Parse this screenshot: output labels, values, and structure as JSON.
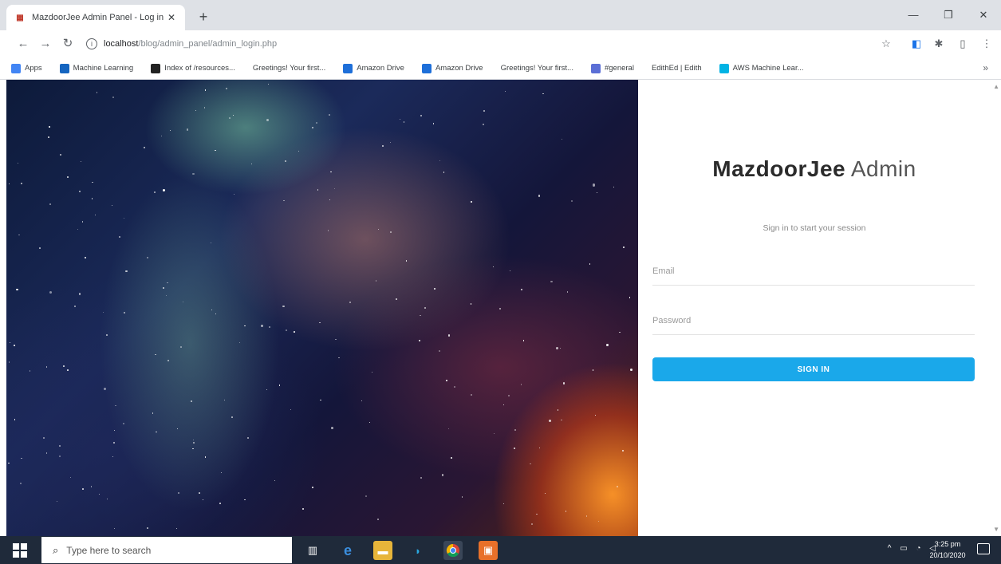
{
  "browser": {
    "tab_title": "MazdoorJee Admin Panel - Log in",
    "url_host": "localhost",
    "url_path": "/blog/admin_panel/admin_login.php",
    "bookmarks": [
      {
        "label": "Apps",
        "icon": "apps-grid-icon",
        "color": "#4285f4"
      },
      {
        "label": "Machine Learning",
        "icon": "infinity-icon",
        "color": "#1565c0"
      },
      {
        "label": "Index of /resources...",
        "icon": "dark-logo-icon",
        "color": "#222222"
      },
      {
        "label": "Greetings! Your first...",
        "icon": "",
        "color": ""
      },
      {
        "label": "Amazon Drive",
        "icon": "amazon-drive-icon",
        "color": "#1e6fd9"
      },
      {
        "label": "Amazon Drive",
        "icon": "amazon-drive-icon",
        "color": "#1e6fd9"
      },
      {
        "label": "Greetings! Your first...",
        "icon": "",
        "color": ""
      },
      {
        "label": "#general",
        "icon": "chat-icon",
        "color": "#5b6fd6"
      },
      {
        "label": "EdithEd | Edith",
        "icon": "",
        "color": ""
      },
      {
        "label": "AWS Machine Lear...",
        "icon": "udacity-icon",
        "color": "#02b3e4"
      }
    ]
  },
  "login": {
    "brand_bold": "MazdoorJee",
    "brand_light": "Admin",
    "subtitle": "Sign in to start your session",
    "email_placeholder": "Email",
    "password_placeholder": "Password",
    "signin_label": "SIGN IN"
  },
  "taskbar": {
    "search_placeholder": "Type here to search",
    "time": "3:25 pm",
    "date": "20/10/2020"
  },
  "colors": {
    "accent": "#1aa8ea",
    "taskbar": "#1f2a3a"
  }
}
